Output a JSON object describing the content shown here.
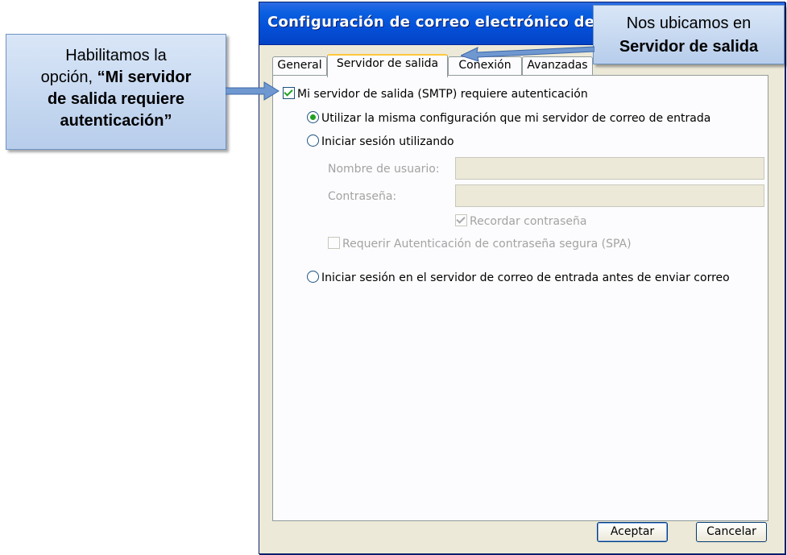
{
  "window": {
    "title": "Configuración de correo electrónico de Int"
  },
  "tabs": [
    {
      "label": "General",
      "active": false
    },
    {
      "label": "Servidor de salida",
      "active": true
    },
    {
      "label": "Conexión",
      "active": false
    },
    {
      "label": "Avanzadas",
      "active": false
    }
  ],
  "smtp_auth": {
    "label": "Mi servidor de salida (SMTP) requiere autenticación",
    "checked": true
  },
  "option_same_config": {
    "label": "Utilizar la misma configuración que mi servidor de correo de entrada",
    "selected": true
  },
  "option_login": {
    "label": "Iniciar sesión utilizando",
    "selected": false
  },
  "username": {
    "label": "Nombre de usuario:",
    "value": ""
  },
  "password": {
    "label": "Contraseña:",
    "value": ""
  },
  "remember_password": {
    "label": "Recordar contraseña",
    "checked": true
  },
  "spa": {
    "label": "Requerir Autenticación de contraseña segura (SPA)",
    "checked": false
  },
  "option_login_before": {
    "label": "Iniciar sesión en el servidor de correo de entrada antes de enviar correo",
    "selected": false
  },
  "buttons": {
    "accept": "Aceptar",
    "cancel": "Cancelar"
  },
  "callout_left": {
    "line1": "Habilitamos la",
    "line2_prefix": "opción,",
    "line2_bold": "“Mi servidor",
    "line3": "de salida requiere",
    "line4": "autenticación”"
  },
  "callout_right": {
    "line1": "Nos ubicamos en",
    "line2": "Servidor de salida"
  },
  "colors": {
    "accent": "#0450d8",
    "callout_fill": "#c6d9f1",
    "check": "#21a121"
  }
}
